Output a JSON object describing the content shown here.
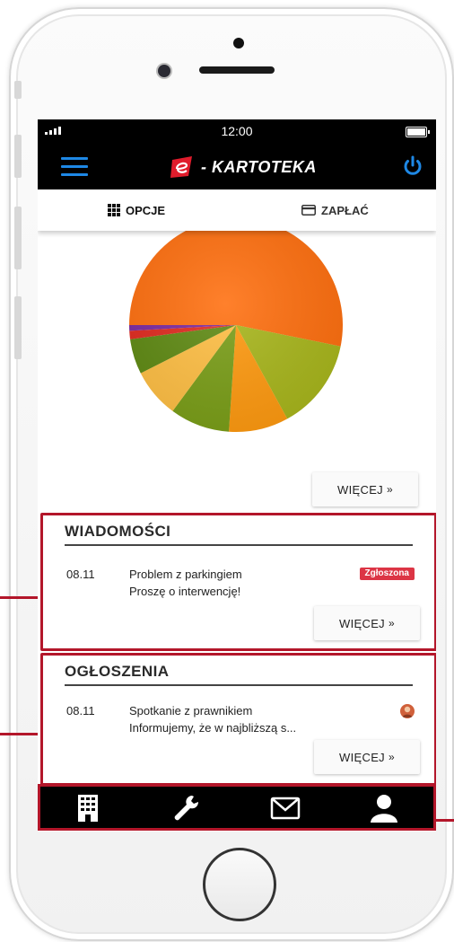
{
  "status_bar": {
    "time": "12:00"
  },
  "app": {
    "brand": "- KARTOTEKA"
  },
  "tabs": [
    {
      "label": "OPCJE",
      "icon": "grid-icon"
    },
    {
      "label": "ZAPŁAĆ",
      "icon": "credit-card-icon"
    }
  ],
  "chart_data": {
    "type": "pie",
    "title": "",
    "slices": [
      {
        "value": 50.0,
        "color": "#ff6f0f"
      },
      {
        "value": 13.0,
        "color": "#a8b61c"
      },
      {
        "value": 8.5,
        "color": "#ff9a10"
      },
      {
        "value": 8.5,
        "color": "#7a9e18"
      },
      {
        "value": 7.0,
        "color": "#ffbf44"
      },
      {
        "value": 5.0,
        "color": "#5f8a13"
      },
      {
        "value": 1.2,
        "color": "#e02a1f"
      },
      {
        "value": 0.8,
        "color": "#7b2aa0"
      }
    ]
  },
  "chart_more": {
    "label": "WIĘCEJ",
    "arrow": "»"
  },
  "messages": {
    "title": "WIADOMOŚCI",
    "items": [
      {
        "date": "08.11",
        "subject": "Problem z parkingiem",
        "body": "Proszę o interwencję!",
        "badge": "Zgłoszona"
      }
    ],
    "more_label": "WIĘCEJ",
    "arrow": "»"
  },
  "announcements": {
    "title": "OGŁOSZENIA",
    "items": [
      {
        "date": "08.11",
        "subject": "Spotkanie z prawnikiem",
        "body": "Informujemy, że w najbliższą s...",
        "icon": "avatar-icon"
      }
    ],
    "more_label": "WIĘCEJ",
    "arrow": "»"
  },
  "bottom_nav": [
    "building-icon",
    "wrench-icon",
    "envelope-icon",
    "user-icon"
  ],
  "colors": {
    "accent_blue": "#1e88e5",
    "highlight_red": "#b3162a",
    "badge_red": "#dc3545"
  }
}
